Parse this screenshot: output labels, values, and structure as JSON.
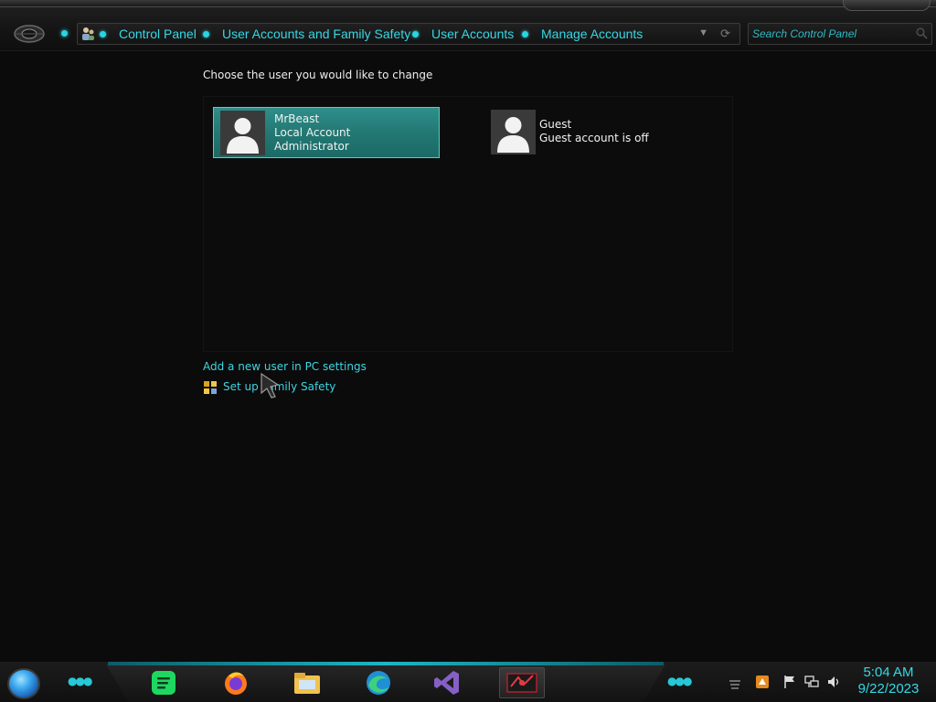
{
  "address_bar": {
    "breadcrumbs": [
      {
        "label": "Control Panel"
      },
      {
        "label": "User Accounts and Family Safety"
      },
      {
        "label": "User Accounts"
      },
      {
        "label": "Manage Accounts"
      }
    ]
  },
  "search": {
    "placeholder": "Search Control Panel"
  },
  "main": {
    "heading": "Choose the user you would like to change",
    "accounts": [
      {
        "name": "MrBeast",
        "type": "Local Account",
        "role": "Administrator",
        "selected": true
      },
      {
        "name": "Guest",
        "status": "Guest account is off",
        "selected": false
      }
    ],
    "add_user_link": "Add a new user in PC settings",
    "family_safety_link": "Set up Family Safety"
  },
  "taskbar": {
    "apps": [
      {
        "icon": "spotify-icon"
      },
      {
        "icon": "firefox-icon"
      },
      {
        "icon": "file-explorer-icon"
      },
      {
        "icon": "edge-icon"
      },
      {
        "icon": "visual-studio-icon"
      },
      {
        "icon": "control-panel-app-icon",
        "active": true
      }
    ],
    "clock": {
      "time": "5:04 AM",
      "date": "9/22/2023"
    }
  },
  "colors": {
    "accent": "#35d8e6",
    "selection": "#237873",
    "background": "#0b0b0b"
  }
}
